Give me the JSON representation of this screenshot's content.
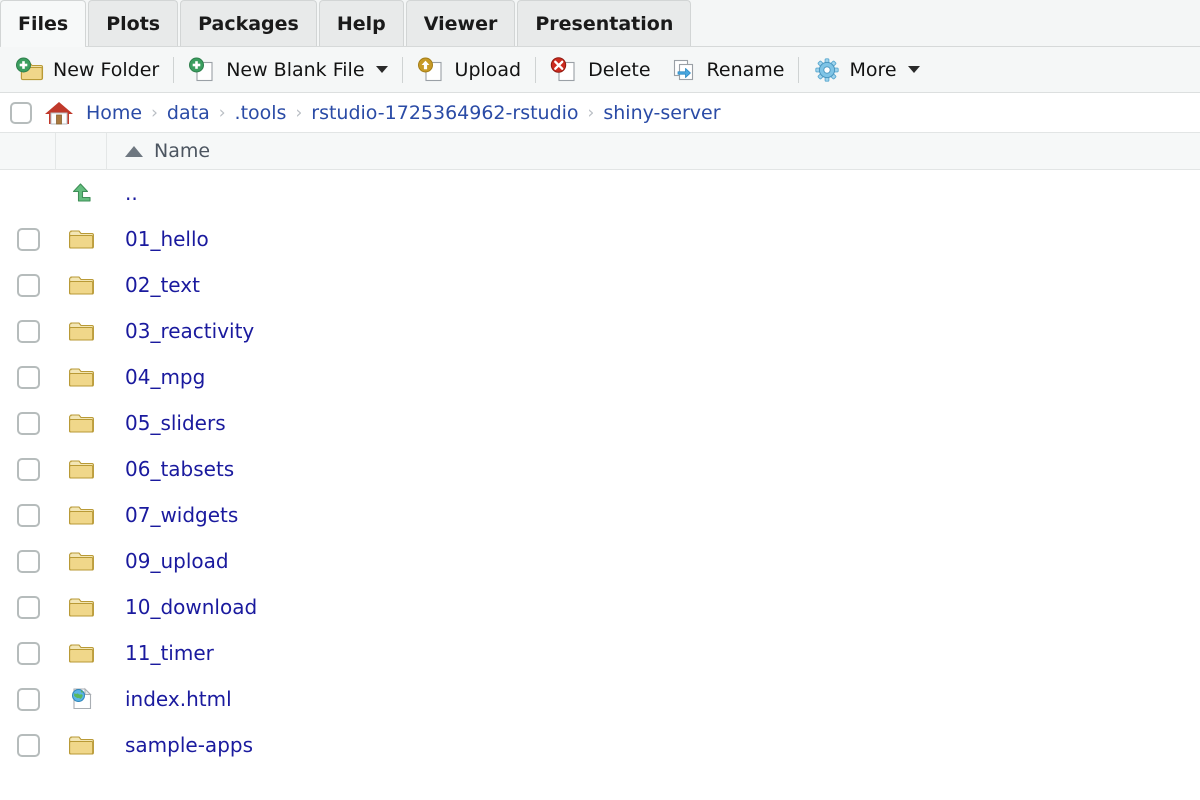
{
  "tabs": [
    {
      "label": "Files",
      "active": true
    },
    {
      "label": "Plots",
      "active": false
    },
    {
      "label": "Packages",
      "active": false
    },
    {
      "label": "Help",
      "active": false
    },
    {
      "label": "Viewer",
      "active": false
    },
    {
      "label": "Presentation",
      "active": false
    }
  ],
  "toolbar": {
    "new_folder_label": "New Folder",
    "new_blank_file_label": "New Blank File",
    "upload_label": "Upload",
    "delete_label": "Delete",
    "rename_label": "Rename",
    "more_label": "More"
  },
  "breadcrumb": {
    "separator": "›",
    "items": [
      {
        "label": "Home"
      },
      {
        "label": "data"
      },
      {
        "label": ".tools"
      },
      {
        "label": "rstudio-1725364962-rstudio"
      },
      {
        "label": "shiny-server"
      }
    ]
  },
  "columns": {
    "name_label": "Name",
    "sort": "ascending"
  },
  "files": [
    {
      "name": "..",
      "type": "parent",
      "checkbox": false
    },
    {
      "name": "01_hello",
      "type": "folder",
      "checkbox": true
    },
    {
      "name": "02_text",
      "type": "folder",
      "checkbox": true
    },
    {
      "name": "03_reactivity",
      "type": "folder",
      "checkbox": true
    },
    {
      "name": "04_mpg",
      "type": "folder",
      "checkbox": true
    },
    {
      "name": "05_sliders",
      "type": "folder",
      "checkbox": true
    },
    {
      "name": "06_tabsets",
      "type": "folder",
      "checkbox": true
    },
    {
      "name": "07_widgets",
      "type": "folder",
      "checkbox": true
    },
    {
      "name": "09_upload",
      "type": "folder",
      "checkbox": true
    },
    {
      "name": "10_download",
      "type": "folder",
      "checkbox": true
    },
    {
      "name": "11_timer",
      "type": "folder",
      "checkbox": true
    },
    {
      "name": "index.html",
      "type": "html",
      "checkbox": true
    },
    {
      "name": "sample-apps",
      "type": "folder",
      "checkbox": true
    }
  ],
  "colors": {
    "link": "#1a1a9e",
    "crumb_link": "#2a4ba6",
    "folder": "#e8c469",
    "tab_active_bg": "#f7f9f9",
    "toolbar_bg": "#f5f7f7",
    "accent_green": "#3a9e5f",
    "accent_red": "#cc2b1f",
    "accent_gold": "#c79a27",
    "accent_blue": "#4aa8e0"
  }
}
